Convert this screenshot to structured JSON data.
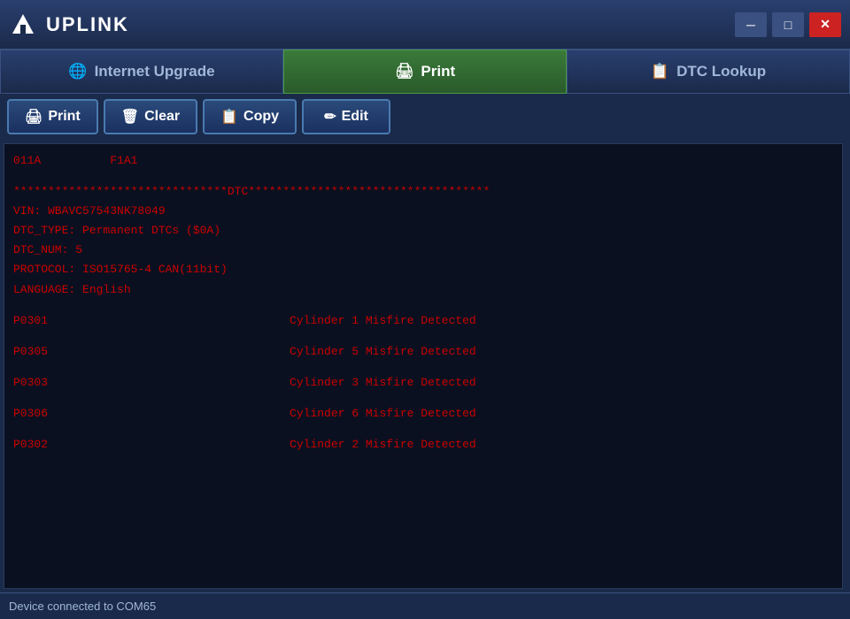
{
  "app": {
    "title": "UPLINK",
    "logo_symbol": "▲"
  },
  "window_controls": {
    "minimize_label": "─",
    "maximize_label": "□",
    "close_label": "✕"
  },
  "nav_tabs": [
    {
      "id": "internet-upgrade",
      "label": "Internet Upgrade",
      "icon": "🌐",
      "active": false
    },
    {
      "id": "print",
      "label": "Print",
      "icon": "🖨",
      "active": true
    },
    {
      "id": "dtc-lookup",
      "label": "DTC Lookup",
      "icon": "📋",
      "active": false
    }
  ],
  "toolbar": {
    "buttons": [
      {
        "id": "print",
        "label": "Print",
        "icon": "🖨"
      },
      {
        "id": "clear",
        "label": "Clear",
        "icon": "🗑"
      },
      {
        "id": "copy",
        "label": "Copy",
        "icon": "📋"
      },
      {
        "id": "edit",
        "label": "Edit",
        "icon": "✏"
      }
    ]
  },
  "content": {
    "lines": [
      {
        "type": "code",
        "text": "011A          F1A1"
      },
      {
        "type": "empty"
      },
      {
        "type": "separator",
        "text": "*******************************DTC***********************************"
      },
      {
        "type": "code",
        "text": "VIN: WBAVC57543NK78049"
      },
      {
        "type": "code",
        "text": "DTC_TYPE: Permanent DTCs ($0A)"
      },
      {
        "type": "code",
        "text": "DTC_NUM: 5"
      },
      {
        "type": "code",
        "text": "PROTOCOL: ISO15765-4 CAN(11bit)"
      },
      {
        "type": "code",
        "text": "LANGUAGE: English"
      },
      {
        "type": "empty"
      },
      {
        "type": "dtc",
        "code": "P0301",
        "desc": "Cylinder 1 Misfire Detected"
      },
      {
        "type": "empty"
      },
      {
        "type": "dtc",
        "code": "P0305",
        "desc": "Cylinder 5 Misfire Detected"
      },
      {
        "type": "empty"
      },
      {
        "type": "dtc",
        "code": "P0303",
        "desc": "Cylinder 3 Misfire Detected"
      },
      {
        "type": "empty"
      },
      {
        "type": "dtc",
        "code": "P0306",
        "desc": "Cylinder 6 Misfire Detected"
      },
      {
        "type": "empty"
      },
      {
        "type": "dtc",
        "code": "P0302",
        "desc": "Cylinder 2 Misfire Detected"
      }
    ]
  },
  "status_bar": {
    "text": "Device connected to COM65"
  }
}
